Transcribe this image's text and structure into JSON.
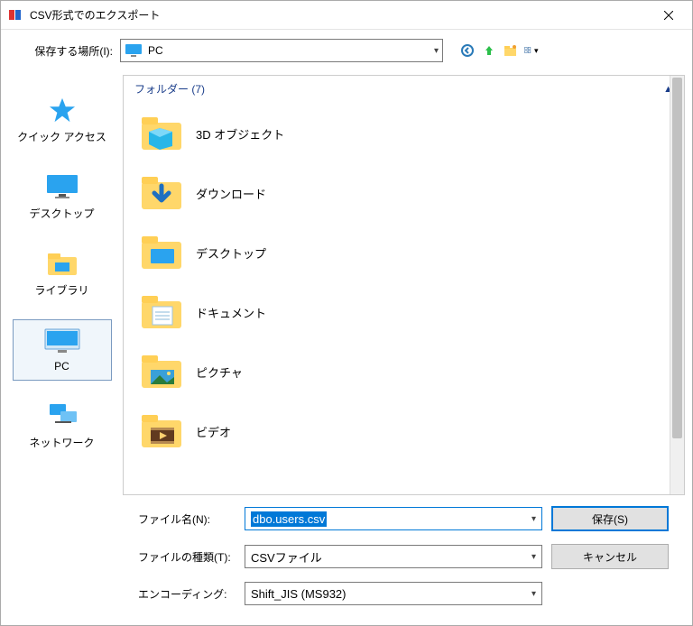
{
  "window": {
    "title": "CSV形式でのエクスポート"
  },
  "toolbar": {
    "location_label": "保存する場所(I):",
    "location_value": "PC"
  },
  "sidebar": {
    "items": [
      {
        "label": "クイック アクセス",
        "icon": "star-icon"
      },
      {
        "label": "デスクトップ",
        "icon": "monitor-icon"
      },
      {
        "label": "ライブラリ",
        "icon": "library-icon"
      },
      {
        "label": "PC",
        "icon": "pc-icon",
        "selected": true
      },
      {
        "label": "ネットワーク",
        "icon": "network-icon"
      }
    ]
  },
  "content": {
    "section_label": "フォルダー (7)",
    "folders": [
      {
        "label": "3D オブジェクト"
      },
      {
        "label": "ダウンロード"
      },
      {
        "label": "デスクトップ"
      },
      {
        "label": "ドキュメント"
      },
      {
        "label": "ピクチャ"
      },
      {
        "label": "ビデオ"
      }
    ]
  },
  "bottom": {
    "filename_label": "ファイル名(N):",
    "filename_value": "dbo.users.csv",
    "filetype_label": "ファイルの種類(T):",
    "filetype_value": "CSVファイル",
    "encoding_label": "エンコーディング:",
    "encoding_value": "Shift_JIS (MS932)",
    "save_label": "保存(S)",
    "cancel_label": "キャンセル"
  }
}
